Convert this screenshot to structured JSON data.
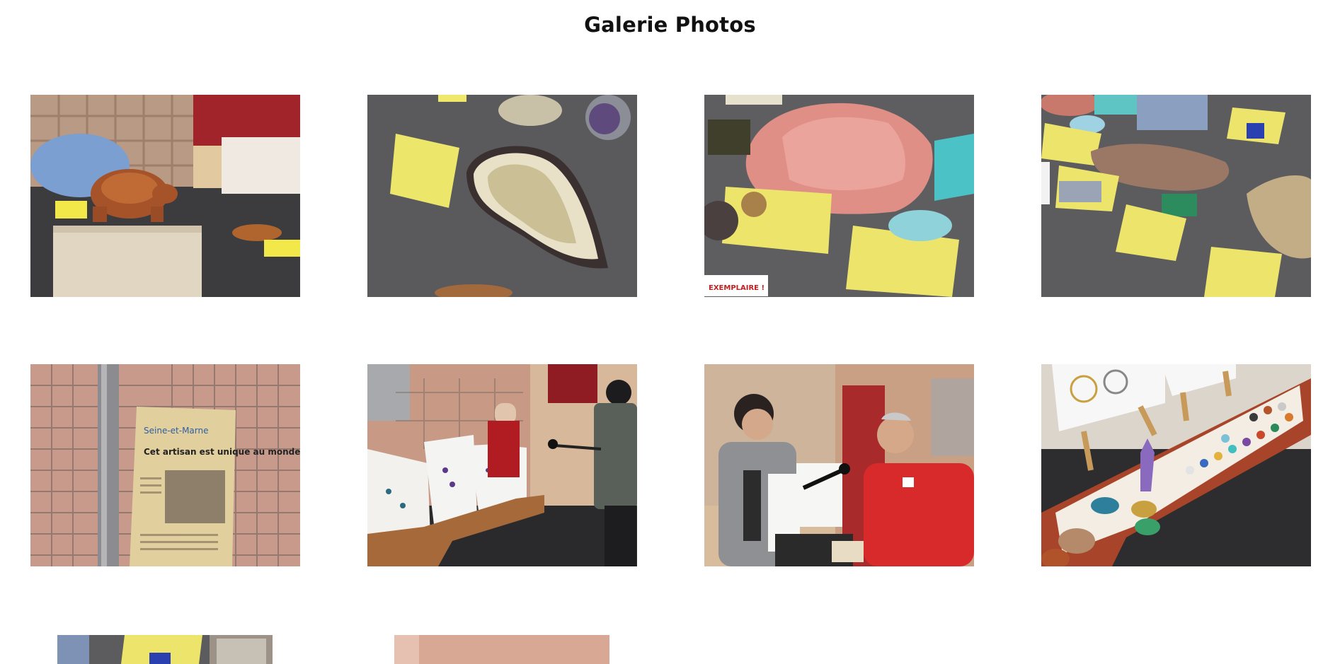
{
  "page": {
    "title": "Galerie Photos"
  },
  "gallery": {
    "photos": [
      {
        "subject": "stone turtle carving on white box",
        "thumb": "photo-1"
      },
      {
        "subject": "polished agate slice with yellow note",
        "thumb": "photo-2"
      },
      {
        "subject": "pink rock salt and turquoise specimens",
        "thumb": "photo-3"
      },
      {
        "subject": "mineral specimens with yellow notes",
        "thumb": "photo-4"
      },
      {
        "subject": "newspaper clipping on wire grid",
        "thumb": "photo-5"
      },
      {
        "subject": "jewelry stand with interviewer",
        "thumb": "photo-6"
      },
      {
        "subject": "interview with exhibitor in red jacket",
        "thumb": "photo-7"
      },
      {
        "subject": "bracelet trays and amethyst",
        "thumb": "photo-8"
      },
      {
        "subject": "minerals partial",
        "thumb": "photo-9"
      },
      {
        "subject": "pink wall partial",
        "thumb": "photo-10"
      }
    ],
    "news_clipping": {
      "masthead": "Seine-et-Marne",
      "headline": "Cet artisan est unique au monde"
    },
    "sticker": "EXEMPLAIRE !"
  }
}
